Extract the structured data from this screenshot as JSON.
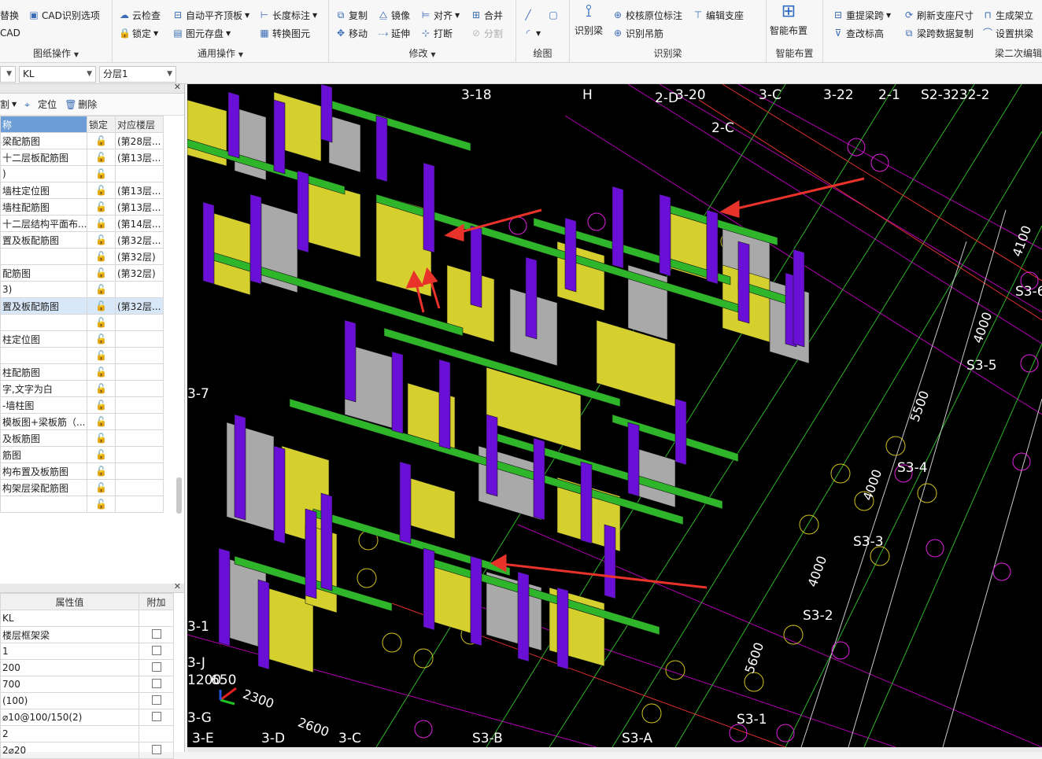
{
  "ribbon": {
    "g1": {
      "title": "图纸操作",
      "items": [
        "替换",
        "CAD识别选项",
        "CAD"
      ]
    },
    "g2": {
      "title": "通用操作",
      "items": [
        "云检查",
        "自动平齐顶板",
        "长度标注",
        "锁定",
        "图元存盘",
        "转换图元"
      ]
    },
    "g3": {
      "title": "修改",
      "items": [
        "复制",
        "镜像",
        "对齐",
        "合并",
        "移动",
        "延伸",
        "打断",
        "分割"
      ]
    },
    "g4": {
      "title": "绘图"
    },
    "g5": {
      "title": "识别梁",
      "big": "识别梁",
      "items": [
        "校核原位标注",
        "编辑支座",
        "识别吊筋"
      ]
    },
    "g6": {
      "title": "智能布置",
      "big": "智能布置"
    },
    "g7": {
      "title": "梁二次编辑",
      "items": [
        "重提梁跨",
        "刷新支座尺寸",
        "生成架立",
        "查改标高",
        "梁跨数据复制",
        "设置拱梁"
      ]
    }
  },
  "selectors": {
    "s0": "",
    "type": "KL",
    "layer": "分层1"
  },
  "left_top": {
    "toolbar": [
      "割",
      "定位",
      "删除"
    ],
    "headers": [
      "称",
      "锁定",
      "对应楼层"
    ],
    "rows": [
      {
        "name": "梁配筋图",
        "floor": "(第28层..."
      },
      {
        "name": "十二层板配筋图",
        "floor": "(第13层..."
      },
      {
        "name": ")",
        "floor": ""
      },
      {
        "name": "墙柱定位图",
        "floor": "(第13层..."
      },
      {
        "name": "墙柱配筋图",
        "floor": "(第13层..."
      },
      {
        "name": "十二层结构平面布...",
        "floor": "(第14层..."
      },
      {
        "name": "置及板配筋图",
        "floor": "(第32层..."
      },
      {
        "name": "",
        "floor": "(第32层)"
      },
      {
        "name": "配筋图",
        "floor": "(第32层)"
      },
      {
        "name": "3)",
        "floor": ""
      },
      {
        "name": "置及板配筋图",
        "floor": "(第32层..."
      },
      {
        "name": "",
        "floor": ""
      },
      {
        "name": "柱定位图",
        "floor": ""
      },
      {
        "name": "",
        "floor": ""
      },
      {
        "name": "柱配筋图",
        "floor": ""
      },
      {
        "name": "字,文字为白",
        "floor": ""
      },
      {
        "name": "-墙柱图",
        "floor": ""
      },
      {
        "name": "模板图+梁板筋（...",
        "floor": ""
      },
      {
        "name": "及板筋图",
        "floor": ""
      },
      {
        "name": "筋图",
        "floor": ""
      },
      {
        "name": "构布置及板筋图",
        "floor": ""
      },
      {
        "name": "构架层梁配筋图",
        "floor": ""
      },
      {
        "name": "",
        "floor": ""
      }
    ]
  },
  "left_bottom": {
    "headers": [
      "属性值",
      "附加"
    ],
    "rows": [
      "KL",
      "楼层框架梁",
      "1",
      "200",
      "700",
      "(100)",
      "⌀10@100/150(2)",
      "2",
      "2⌀20"
    ]
  },
  "canvas": {
    "axis_labels": [
      "3-18",
      "H",
      "2-D",
      "3-20",
      "3-C",
      "3-22",
      "2-1",
      "S2-3",
      "232-2",
      "2-C",
      "S3-6",
      "S3-5",
      "S3-4",
      "S3-3",
      "S3-2",
      "S3-1",
      "3-7",
      "3-1",
      "3-J",
      "3-G",
      "3-E",
      "3-D",
      "3-C",
      "S3-B",
      "S3-A",
      "1200",
      "650"
    ],
    "dims": [
      "4100",
      "4000",
      "5500",
      "4000",
      "4000",
      "5600",
      "2300",
      "2600"
    ]
  },
  "colors": {
    "yellow": "#d6d02e",
    "green": "#2fb52a",
    "purple": "#6a10d6",
    "grey": "#a9a9a9",
    "arrow": "#e8322a"
  }
}
